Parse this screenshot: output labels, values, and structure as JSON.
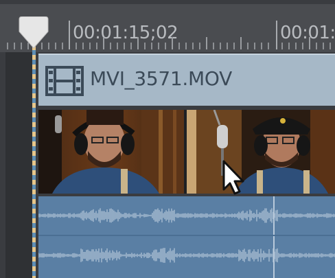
{
  "ruler": {
    "timecodes": [
      "00:01:15;02",
      "00:01:"
    ]
  },
  "clip": {
    "name": "MVI_3571.MOV",
    "icon": "film-strip-icon"
  },
  "colors": {
    "clip_header": "#a6b8c7",
    "audio_track": "#5a7fa4",
    "playhead_dash_a": "#e7c78b",
    "playhead_dash_b": "#5e8fb6"
  }
}
